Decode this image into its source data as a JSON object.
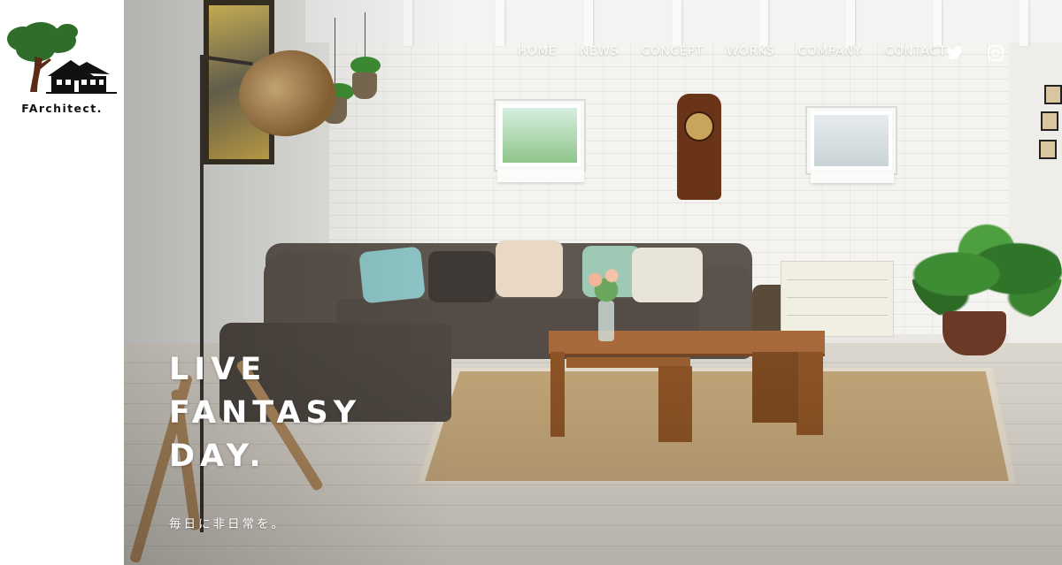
{
  "brand": {
    "name": "FArchitect.",
    "logo_icon": "tree-and-house-logo"
  },
  "nav": {
    "items": [
      {
        "label": "HOME"
      },
      {
        "label": "NEWS"
      },
      {
        "label": "CONCEPT"
      },
      {
        "label": "WORKS"
      },
      {
        "label": "COMPANY"
      },
      {
        "label": "CONTACT"
      }
    ],
    "social": [
      {
        "icon": "twitter-icon"
      },
      {
        "icon": "instagram-icon"
      }
    ]
  },
  "hero": {
    "headline": [
      "LIVE",
      "FANTASY",
      "DAY."
    ],
    "subcopy": "毎日に非日常を。",
    "image_subject": "living-room-photo"
  },
  "colors": {
    "nav_text": "#ffffff",
    "logo_tree": "#2f6e2a",
    "logo_house": "#111111"
  }
}
